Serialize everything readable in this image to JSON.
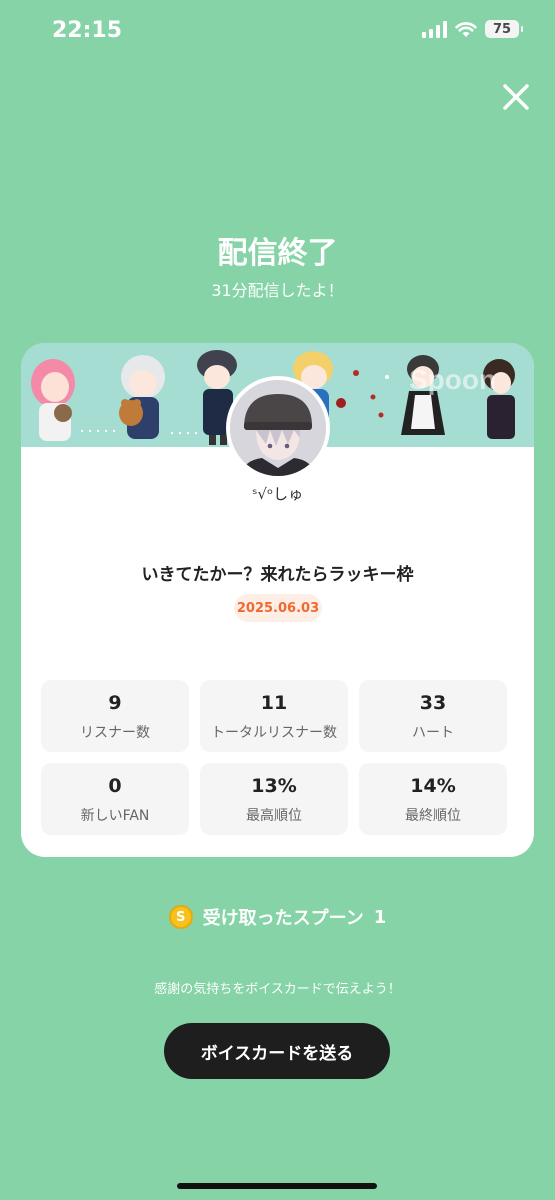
{
  "status_bar": {
    "time": "22:15",
    "battery": "75"
  },
  "header": {
    "title": "配信終了",
    "subtitle": "31分配信したよ！"
  },
  "card": {
    "banner_logo": "Spoon",
    "username": "ˢ√ᵒしゅ",
    "stream_title": "いきてたかー？来れたらラッキー枠",
    "date": "2025.06.03",
    "stats": [
      {
        "value": "9",
        "label": "リスナー数"
      },
      {
        "value": "11",
        "label": "トータルリスナー数"
      },
      {
        "value": "33",
        "label": "ハート"
      },
      {
        "value": "0",
        "label": "新しいFAN"
      },
      {
        "value": "13%",
        "label": "最高順位"
      },
      {
        "value": "14%",
        "label": "最終順位"
      }
    ]
  },
  "spoons": {
    "coin_letter": "S",
    "label": "受け取ったスプーン",
    "count": "1"
  },
  "footer": {
    "thanks_text": "感謝の気持ちをボイスカードで伝えよう！",
    "button_label": "ボイスカードを送る"
  },
  "colors": {
    "background": "#85d3a6",
    "date_accent": "#f0692f",
    "button": "#1e1e1e",
    "coin": "#f7c21d"
  }
}
